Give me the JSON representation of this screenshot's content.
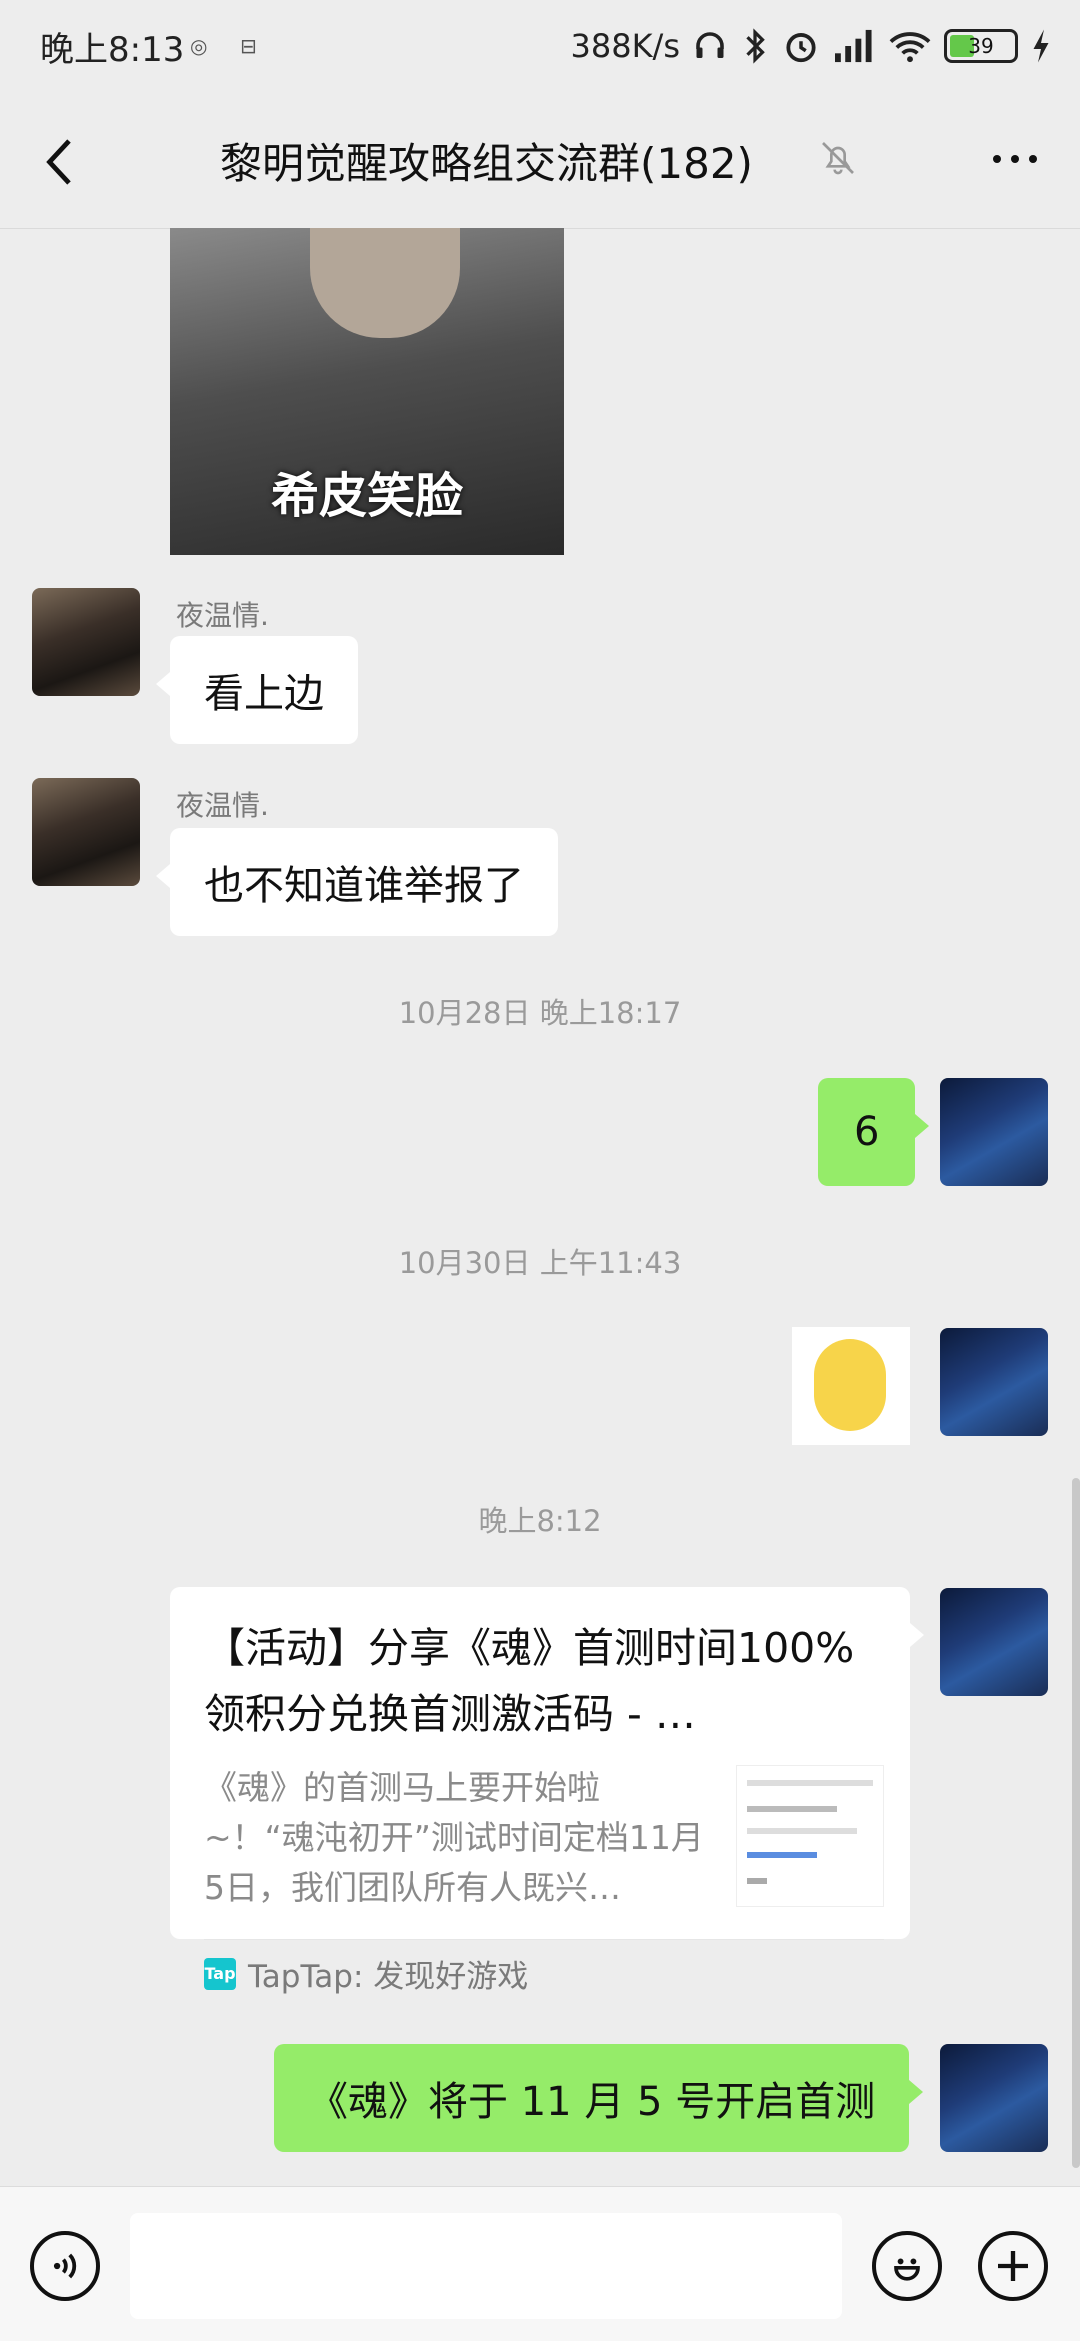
{
  "status_bar": {
    "time": "晚上8:13",
    "net_speed": "388K/s",
    "battery": "39",
    "battery_level": 0.39,
    "icons": [
      "notification-icon",
      "notification-icon",
      "headphones-icon",
      "bluetooth-icon",
      "alarm-icon",
      "signal-icon",
      "wifi-icon",
      "battery-icon",
      "charging-icon"
    ]
  },
  "header": {
    "title": "黎明觉醒攻略组交流群(182)",
    "icons": [
      "back-icon",
      "mute-bell-icon",
      "more-icon"
    ]
  },
  "messages": {
    "sticker1_caption": "希皮笑脸",
    "msg1_sender": "夜温情.",
    "msg1_text": "看上边",
    "msg2_sender": "夜温情.",
    "msg2_text": "也不知道谁举报了",
    "ts1": "10月28日 晚上18:17",
    "msg3_text": "6",
    "ts2": "10月30日 上午11:43",
    "ts3": "晚上8:12",
    "card_title": "【活动】分享《魂》首测时间100%领积分兑换首测激活码 - …",
    "card_desc": "《魂》的首测马上要开始啦~！“魂沌初开”测试时间定档11月5日，我们团队所有人既兴…",
    "card_logo": "Tap",
    "card_source": "TapTap: 发现好游戏",
    "msg5_text": "《魂》将于 11 月 5 号开启首测"
  },
  "input_bar": {
    "placeholder": "",
    "icons": [
      "voice-icon",
      "emoji-icon",
      "plus-icon"
    ]
  },
  "colors": {
    "background": "#ededed",
    "self_bubble": "#95ec69",
    "other_bubble": "#ffffff"
  }
}
